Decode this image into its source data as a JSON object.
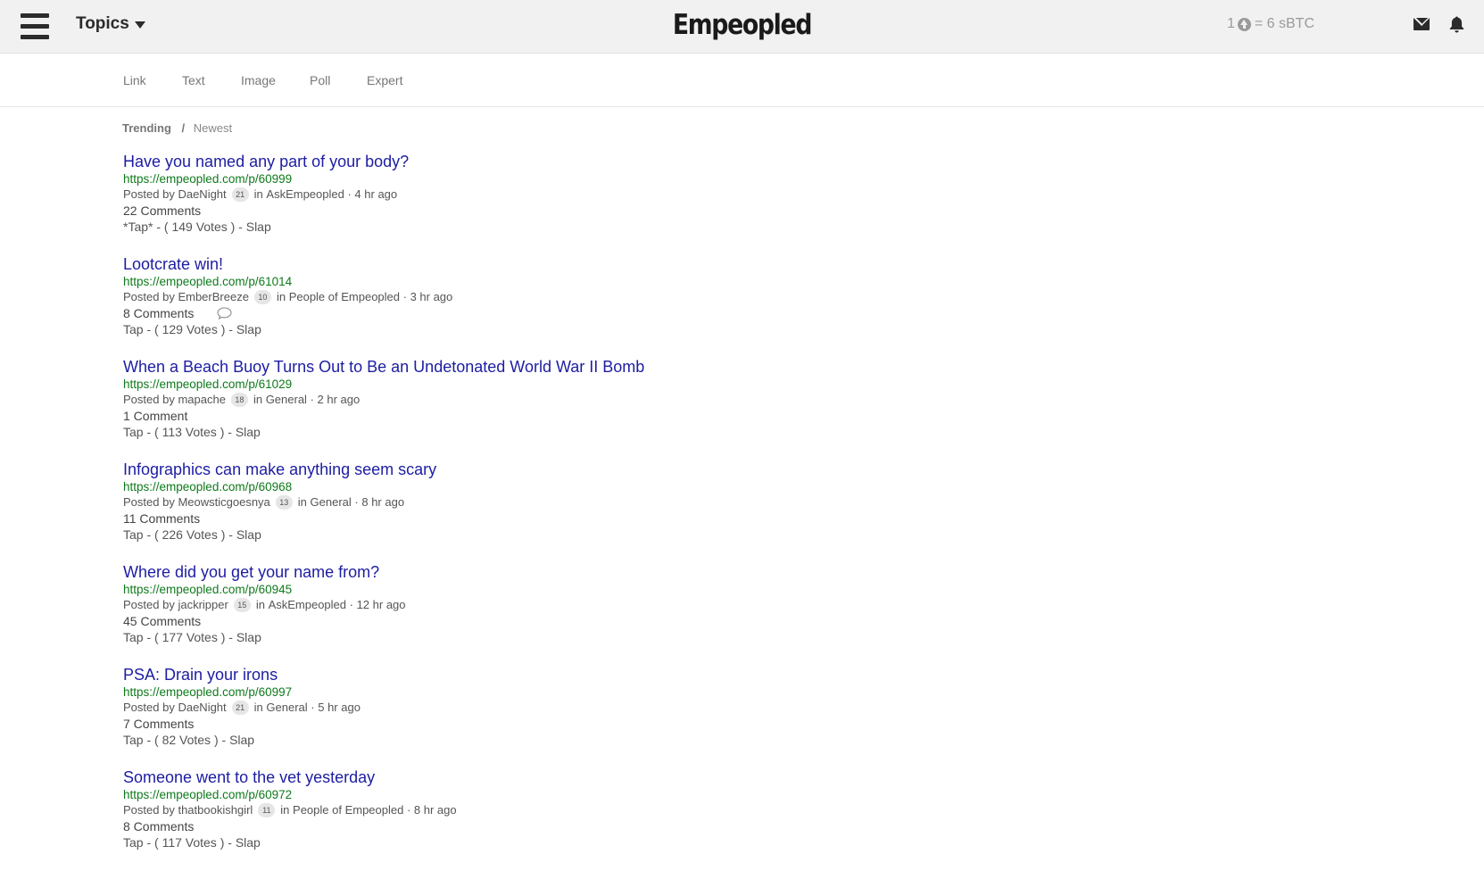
{
  "header": {
    "topics_label": "Topics",
    "brand": "Empeopled",
    "rate_prefix": "1",
    "rate_suffix": "= 6 sBTC",
    "icons": [
      "menu-icon",
      "caret-down-icon",
      "upvote-coin-icon",
      "mail-icon",
      "bell-icon"
    ]
  },
  "subnav": {
    "items": [
      {
        "label": "Link"
      },
      {
        "label": "Text"
      },
      {
        "label": "Image"
      },
      {
        "label": "Poll"
      },
      {
        "label": "Expert"
      }
    ]
  },
  "sort": {
    "active": "Trending",
    "separator": "/",
    "inactive": "Newest"
  },
  "posts": [
    {
      "title": "Have you named any part of your body?",
      "url": "https://empeopled.com/p/60999",
      "posted_by": "Posted by",
      "author": "DaeNight",
      "karma": "21",
      "in": "in",
      "topic": "AskEmpeopled",
      "time": "· 4 hr ago",
      "comments": "22 Comments",
      "tap": "*Tap*",
      "votes": " - ( 149 Votes ) - ",
      "slap": "Slap"
    },
    {
      "title": "Lootcrate win!",
      "url": "https://empeopled.com/p/61014",
      "posted_by": "Posted by",
      "author": "EmberBreeze",
      "karma": "10",
      "in": "in",
      "topic": "People of Empeopled",
      "time": "· 3 hr ago",
      "comments": "8 Comments",
      "has_comment_icon": true,
      "tap": "Tap",
      "votes": " - ( 129 Votes ) - ",
      "slap": "Slap"
    },
    {
      "title": "When a Beach Buoy Turns Out to Be an Undetonated World War II Bomb",
      "url": "https://empeopled.com/p/61029",
      "posted_by": "Posted by",
      "author": "mapache",
      "karma": "18",
      "in": "in",
      "topic": "General",
      "time": "· 2 hr ago",
      "comments": "1 Comment",
      "tap": "Tap",
      "votes": " - ( 113 Votes ) - ",
      "slap": "Slap"
    },
    {
      "title": "Infographics can make anything seem scary",
      "url": "https://empeopled.com/p/60968",
      "posted_by": "Posted by",
      "author": "Meowsticgoesnya",
      "karma": "13",
      "in": "in",
      "topic": "General",
      "time": "· 8 hr ago",
      "comments": "11 Comments",
      "tap": "Tap",
      "votes": " - ( 226 Votes ) - ",
      "slap": "Slap"
    },
    {
      "title": "Where did you get your name from?",
      "url": "https://empeopled.com/p/60945",
      "posted_by": "Posted by",
      "author": "jackripper",
      "karma": "15",
      "in": "in",
      "topic": "AskEmpeopled",
      "time": "· 12 hr ago",
      "comments": "45 Comments",
      "tap": "Tap",
      "votes": " - ( 177 Votes ) - ",
      "slap": "Slap"
    },
    {
      "title": "PSA: Drain your irons",
      "url": "https://empeopled.com/p/60997",
      "posted_by": "Posted by",
      "author": "DaeNight",
      "karma": "21",
      "in": "in",
      "topic": "General",
      "time": "· 5 hr ago",
      "comments": "7 Comments",
      "tap": "Tap",
      "votes": " - ( 82 Votes ) - ",
      "slap": "Slap"
    },
    {
      "title": "Someone went to the vet yesterday",
      "url": "https://empeopled.com/p/60972",
      "posted_by": "Posted by",
      "author": "thatbookishgirl",
      "karma": "11",
      "in": "in",
      "topic": "People of Empeopled",
      "time": "· 8 hr ago",
      "comments": "8 Comments",
      "tap": "Tap",
      "votes": " - ( 117 Votes ) - ",
      "slap": "Slap"
    }
  ],
  "colors": {
    "header_bg": "#f1f1f1",
    "title_link": "#1d1da3",
    "url_green": "#0e7a1b",
    "meta_gray": "#555555"
  }
}
